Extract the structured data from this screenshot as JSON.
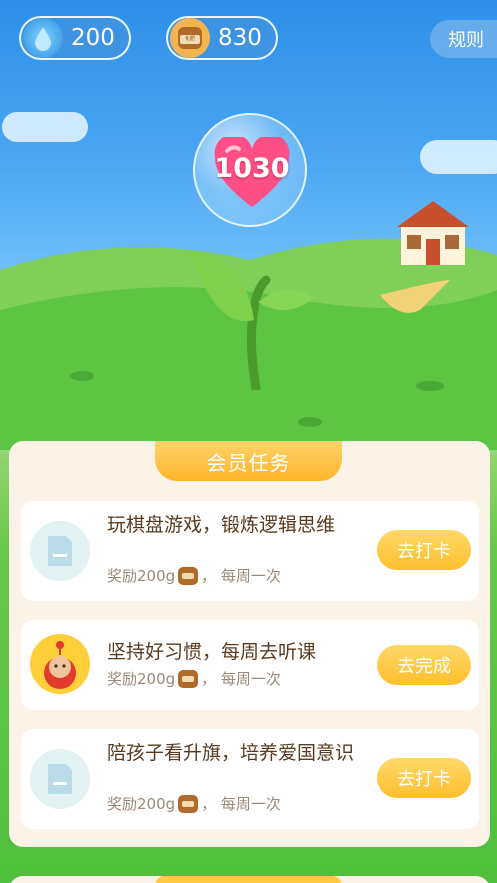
{
  "header": {
    "water_count": "200",
    "fertilizer_count": "830",
    "rules_label": "规则",
    "fertilizer_bag_text": "化肥"
  },
  "hearts": {
    "value": "1030"
  },
  "tasks_section": {
    "title": "会员任务",
    "items": [
      {
        "title": "玩棋盘游戏，锻炼逻辑思维",
        "reward_prefix": "奖励200g",
        "reward_suffix": "，  每周一次",
        "button": "去打卡",
        "avatar": "document-icon"
      },
      {
        "title": "坚持好习惯，每周去听课",
        "reward_prefix": "奖励200g",
        "reward_suffix": "，  每周一次",
        "button": "去完成",
        "avatar": "monkey-mascot-icon"
      },
      {
        "title": "陪孩子看升旗，培养爱国意识",
        "reward_prefix": "奖励200g",
        "reward_suffix": "，  每周一次",
        "button": "去打卡",
        "avatar": "document-icon"
      }
    ]
  },
  "colors": {
    "accent": "#ffbf2c",
    "heart": "#ff4f86",
    "panel": "#fcf3e8"
  }
}
